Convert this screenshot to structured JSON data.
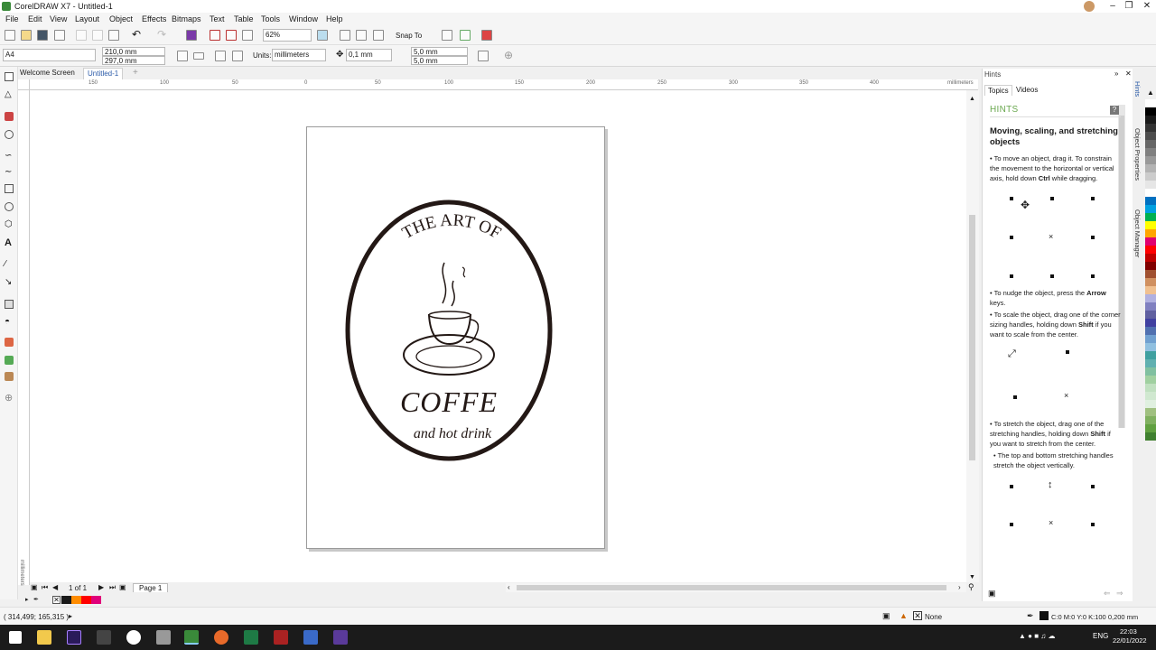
{
  "window": {
    "title": "CorelDRAW X7 - Untitled-1"
  },
  "menu": [
    "File",
    "Edit",
    "View",
    "Layout",
    "Object",
    "Effects",
    "Bitmaps",
    "Text",
    "Table",
    "Tools",
    "Window",
    "Help"
  ],
  "toolbar": {
    "zoom": "62%",
    "snap_to": "Snap To"
  },
  "propertybar": {
    "page_size": "A4",
    "width": "210,0 mm",
    "height": "297,0 mm",
    "units_label": "Units:",
    "units_value": "millimeters",
    "nudge": "0,1 mm",
    "dup_x": "5,0 mm",
    "dup_y": "5,0 mm"
  },
  "tabs": [
    "Welcome Screen",
    "Untitled-1"
  ],
  "ruler": {
    "h_labels": [
      "150",
      "100",
      "50",
      "0",
      "50",
      "100",
      "150",
      "200",
      "250",
      "300",
      "350",
      "400"
    ],
    "h_unit": "millimeters",
    "v_unit": "millimeters"
  },
  "artwork": {
    "arc_text": "THE ART OF",
    "main_text": "COFFE",
    "sub_text": "and hot drink"
  },
  "pagenav": {
    "count": "1 of 1",
    "page_tab": "Page 1"
  },
  "status": {
    "coords": "( 314,499; 165,315 )",
    "fill": "None",
    "outline": "C:0 M:0 Y:0 K:100  0,200 mm"
  },
  "hints": {
    "panel_title": "Hints",
    "tab_topics": "Topics",
    "tab_videos": "Videos",
    "heading": "HINTS",
    "title": "Moving, scaling, and stretching objects",
    "p1_a": "To move an object, drag it. To constrain the movement to the horizontal or vertical axis, hold down ",
    "p1_b": "Ctrl",
    "p1_c": " while dragging.",
    "p2_a": "To nudge the object, press the ",
    "p2_b": "Arrow",
    "p2_c": " keys.",
    "p3_a": "To scale the object, drag one of the corner sizing handles, holding down ",
    "p3_b": "Shift",
    "p3_c": " if you want to scale from the center.",
    "p4_a": "To stretch the object, drag one of the stretching handles, holding down ",
    "p4_b": "Shift",
    "p4_c": " if you want to stretch from the center.",
    "p5": "The top and bottom stretching handles stretch the object vertically."
  },
  "docker_tabs": [
    "Hints",
    "Object Properties",
    "Object Manager"
  ],
  "palette_colors": [
    "#ffffff",
    "#000000",
    "#1a1a1a",
    "#333333",
    "#4d4d4d",
    "#666666",
    "#808080",
    "#999999",
    "#b3b3b3",
    "#cccccc",
    "#e6e6e6",
    "#ffffff",
    "#0070c0",
    "#00a0e0",
    "#00b050",
    "#ffff00",
    "#ffa500",
    "#e00070",
    "#ff0000",
    "#c00000",
    "#800000",
    "#a05030",
    "#d09060",
    "#f0c090",
    "#b0b0e0",
    "#8080c0",
    "#6060a0",
    "#4040a0",
    "#5070b0",
    "#70a0d0",
    "#90c0e0",
    "#40a0a0",
    "#60b0b0",
    "#80c0a0",
    "#a0d0a0",
    "#c0e0c0",
    "#d0e8d0",
    "#e0f0e0",
    "#a0c080",
    "#80b060",
    "#60a040",
    "#408030"
  ],
  "bottom_palette": [
    "#1a1a1a",
    "#ff8c00",
    "#ff0000",
    "#e0007a"
  ],
  "clock": {
    "time": "22:03",
    "date": "22/01/2022"
  },
  "lang": "ENG"
}
